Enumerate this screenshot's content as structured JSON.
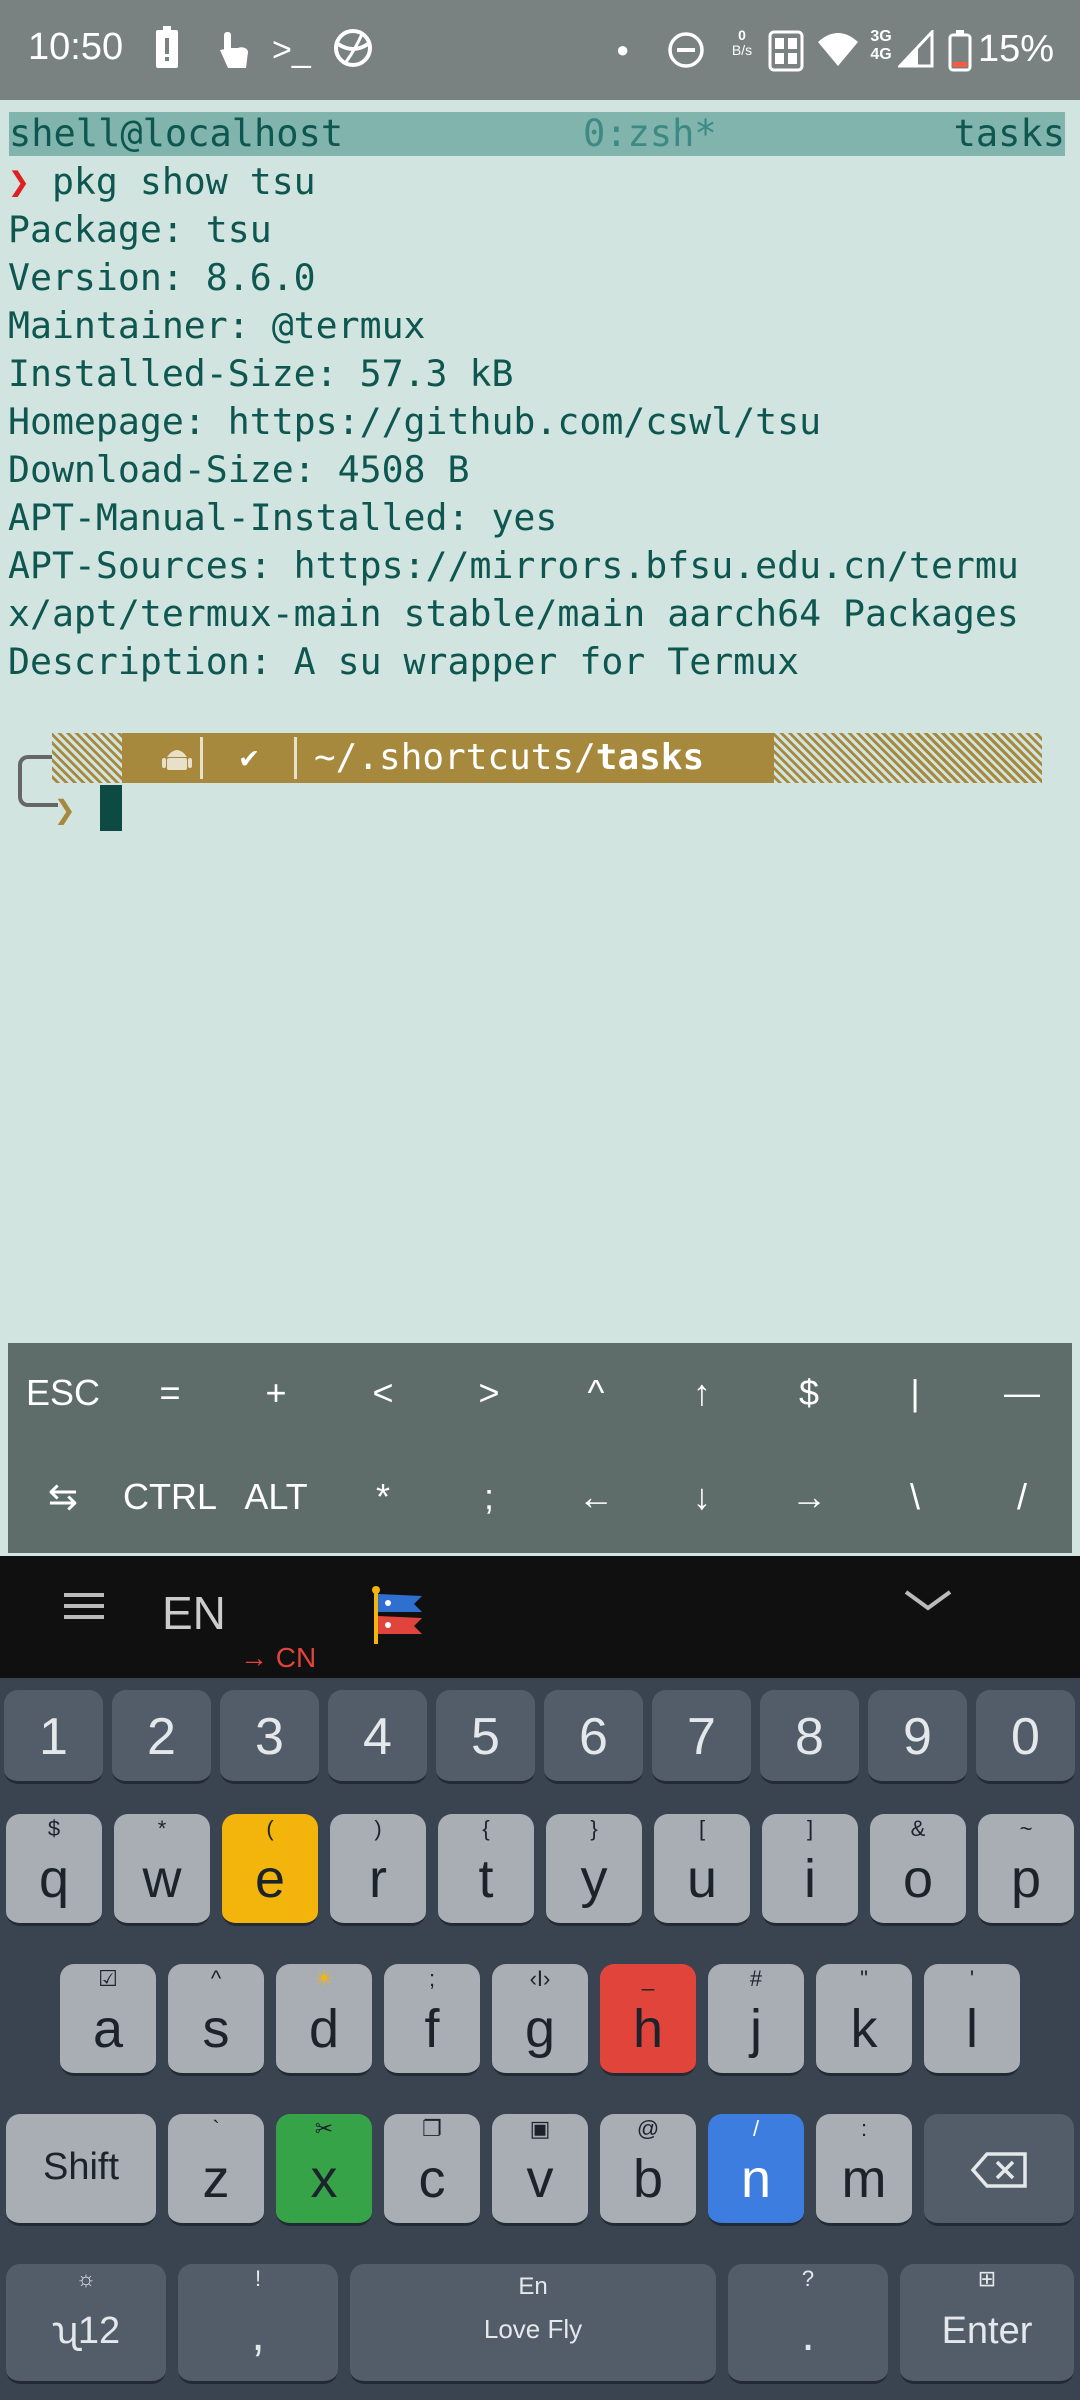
{
  "status_bar": {
    "time": "10:50",
    "net_speed_value": "0",
    "net_speed_unit": "B/s",
    "network_type_top": "3G",
    "network_type_bottom": "4G",
    "battery_percent": "15%"
  },
  "terminal": {
    "tmux": {
      "left": "shell@localhost",
      "center": "0:zsh*",
      "right": "tasks"
    },
    "command_prompt_symbol": "❯",
    "command": " pkg show tsu",
    "output_lines": [
      "Package: tsu",
      "Version: 8.6.0",
      "Maintainer: @termux",
      "Installed-Size: 57.3 kB",
      "Homepage: https://github.com/cswl/tsu",
      "Download-Size: 4508 B",
      "APT-Manual-Installed: yes",
      "APT-Sources: https://mirrors.bfsu.edu.cn/termu",
      "x/apt/termux-main stable/main aarch64 Packages",
      "Description: A su wrapper for Termux"
    ],
    "prompt": {
      "status": "✔",
      "path_prefix": "~/.shortcuts/",
      "path_dir": "tasks",
      "chevron": "❯"
    }
  },
  "extra_keys": {
    "row1": [
      "ESC",
      "=",
      "+",
      "<",
      ">",
      "^",
      "↑",
      "$",
      "|",
      "—"
    ],
    "row2": [
      "⇆",
      "CTRL",
      "ALT",
      "*",
      ";",
      "←",
      "↓",
      "→",
      "\\",
      "/"
    ]
  },
  "keyboard": {
    "language": "EN",
    "switch_target": "→ CN",
    "numbers": [
      "1",
      "2",
      "3",
      "4",
      "5",
      "6",
      "7",
      "8",
      "9",
      "0"
    ],
    "row_q": [
      {
        "k": "q",
        "s": "$"
      },
      {
        "k": "w",
        "s": "*"
      },
      {
        "k": "e",
        "s": "("
      },
      {
        "k": "r",
        "s": ")"
      },
      {
        "k": "t",
        "s": "{"
      },
      {
        "k": "y",
        "s": "}"
      },
      {
        "k": "u",
        "s": "["
      },
      {
        "k": "i",
        "s": "]"
      },
      {
        "k": "o",
        "s": "&"
      },
      {
        "k": "p",
        "s": "~"
      }
    ],
    "row_a": [
      {
        "k": "a",
        "s": "☑"
      },
      {
        "k": "s",
        "s": "^"
      },
      {
        "k": "d",
        "s": "☀"
      },
      {
        "k": "f",
        "s": ";"
      },
      {
        "k": "g",
        "s": "‹I›"
      },
      {
        "k": "h",
        "s": "_"
      },
      {
        "k": "j",
        "s": "#"
      },
      {
        "k": "k",
        "s": "\""
      },
      {
        "k": "l",
        "s": "'"
      }
    ],
    "row_z": [
      {
        "k": "z",
        "s": "`"
      },
      {
        "k": "x",
        "s": "✂"
      },
      {
        "k": "c",
        "s": "❐"
      },
      {
        "k": "v",
        "s": "▣"
      },
      {
        "k": "b",
        "s": "@"
      },
      {
        "k": "n",
        "s": "/"
      },
      {
        "k": "m",
        "s": ":"
      }
    ],
    "shift_label": "Shift",
    "symbols_label": "ʯ12",
    "symbols_sub": "☼",
    "comma_label": ",",
    "comma_sub": "!",
    "space_label": "Love Fly",
    "space_sub": "En",
    "period_label": ".",
    "period_sub": "?",
    "enter_label": "Enter",
    "enter_sub": "⊞"
  },
  "colors": {
    "yellow": "#f3b50c",
    "red": "#e0443a",
    "green": "#37a349",
    "blue": "#3e7de0"
  }
}
